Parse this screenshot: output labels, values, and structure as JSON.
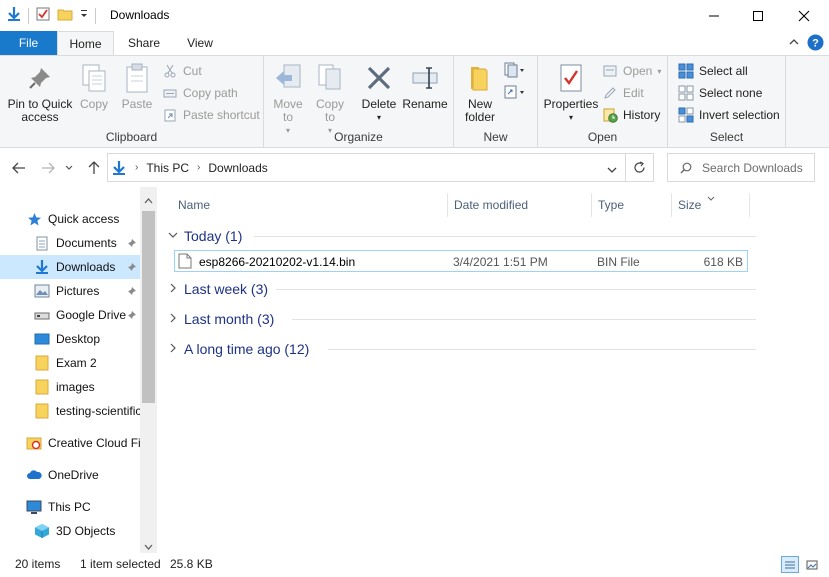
{
  "window": {
    "title": "Downloads",
    "minimize": "—",
    "maximize": "☐",
    "close": "✕"
  },
  "ribbon_tabs": {
    "file": "File",
    "home": "Home",
    "share": "Share",
    "view": "View"
  },
  "ribbon": {
    "clipboard": {
      "label": "Clipboard",
      "pin": "Pin to Quick access",
      "copy": "Copy",
      "paste": "Paste",
      "cut": "Cut",
      "copy_path": "Copy path",
      "paste_shortcut": "Paste shortcut"
    },
    "organize": {
      "label": "Organize",
      "move_to": "Move to",
      "copy_to": "Copy to",
      "delete": "Delete",
      "rename": "Rename"
    },
    "new": {
      "label": "New",
      "new_folder": "New folder"
    },
    "open": {
      "label": "Open",
      "properties": "Properties",
      "open": "Open",
      "edit": "Edit",
      "history": "History"
    },
    "select": {
      "label": "Select",
      "select_all": "Select all",
      "select_none": "Select none",
      "invert": "Invert selection"
    }
  },
  "address": {
    "crumbs": [
      "This PC",
      "Downloads"
    ],
    "search_placeholder": "Search Downloads"
  },
  "nav_pane": {
    "items": [
      {
        "label": "Quick access",
        "icon": "star-icon",
        "pinned": false
      },
      {
        "label": "Documents",
        "icon": "documents-icon",
        "pinned": true
      },
      {
        "label": "Downloads",
        "icon": "download-arrow-icon",
        "pinned": true,
        "selected": true
      },
      {
        "label": "Pictures",
        "icon": "pictures-icon",
        "pinned": true
      },
      {
        "label": "Google Drive",
        "icon": "drive-icon",
        "pinned": true
      },
      {
        "label": "Desktop",
        "icon": "desktop-icon",
        "pinned": false
      },
      {
        "label": "Exam 2",
        "icon": "folder-icon",
        "pinned": false
      },
      {
        "label": "images",
        "icon": "folder-icon",
        "pinned": false
      },
      {
        "label": "testing-scientific",
        "icon": "folder-icon",
        "pinned": false
      },
      {
        "label": "Creative Cloud Fil",
        "icon": "creative-cloud-icon",
        "pinned": false
      },
      {
        "label": "OneDrive",
        "icon": "cloud-icon",
        "pinned": false
      },
      {
        "label": "This PC",
        "icon": "computer-icon",
        "pinned": false
      },
      {
        "label": "3D Objects",
        "icon": "cube-icon",
        "pinned": false
      }
    ]
  },
  "file_list": {
    "columns": [
      "Name",
      "Date modified",
      "Type",
      "Size"
    ],
    "groups": [
      {
        "label": "Today (1)",
        "expanded": true
      },
      {
        "label": "Last week (3)",
        "expanded": false
      },
      {
        "label": "Last month (3)",
        "expanded": false
      },
      {
        "label": "A long time ago (12)",
        "expanded": false
      }
    ],
    "file": {
      "name": "esp8266-20210202-v1.14.bin",
      "date": "3/4/2021 1:51 PM",
      "type": "BIN File",
      "size": "618 KB"
    }
  },
  "status": {
    "items": "20 items",
    "selected": "1 item selected",
    "selected_size": "25.8 KB"
  },
  "colors": {
    "accent": "#1979ca",
    "selection": "#cce8ff",
    "group_header": "#1e3287",
    "column_header": "#4c607a"
  }
}
